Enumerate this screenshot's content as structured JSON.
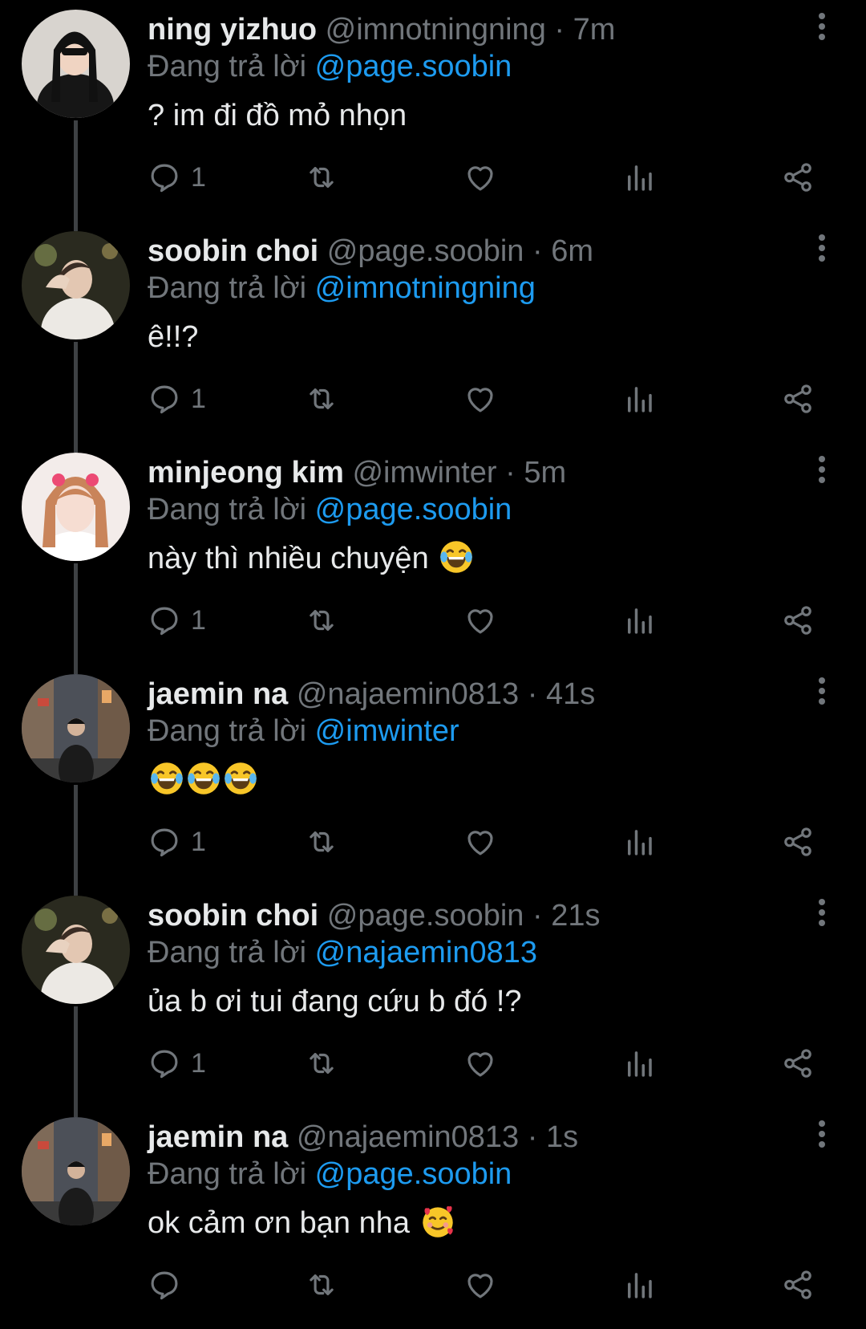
{
  "colors": {
    "background": "#000000",
    "text": "#e7e9ea",
    "muted": "#71767b",
    "mention": "#1d9bf0",
    "thread_line": "#3e4144"
  },
  "icons": {
    "reply": "speech-bubble-icon",
    "retweet": "retweet-icon",
    "like": "heart-icon",
    "views": "bar-chart-icon",
    "share": "share-icon",
    "more": "vertical-dots-icon"
  },
  "reply_prefix": "Đang trả lời",
  "tweets": [
    {
      "name": "ning yizhuo",
      "handle": "@imnotningning",
      "sep": " · ",
      "time": "7m",
      "reply_to": "@page.soobin",
      "text": "? im đi đồ mỏ nhọn",
      "emoji": "",
      "reply_count": "1"
    },
    {
      "name": "soobin choi",
      "handle": "@page.soobin",
      "sep": " · ",
      "time": "6m",
      "reply_to": "@imnotningning",
      "text": "ê!!?",
      "emoji": "",
      "reply_count": "1"
    },
    {
      "name": "minjeong kim",
      "handle": "@imwinter",
      "sep": " · ",
      "time": "5m",
      "reply_to": "@page.soobin",
      "text": "này thì nhiều chuyện ",
      "emoji": "😂",
      "reply_count": "1"
    },
    {
      "name": "jaemin na",
      "handle": "@najaemin0813",
      "sep": " · ",
      "time": "41s",
      "reply_to": "@imwinter",
      "text": "",
      "emoji": "😂😂😂",
      "reply_count": "1"
    },
    {
      "name": "soobin choi",
      "handle": "@page.soobin",
      "sep": " · ",
      "time": "21s",
      "reply_to": "@najaemin0813",
      "text": "ủa b ơi tui đang cứu b đó !?",
      "emoji": "",
      "reply_count": "1"
    },
    {
      "name": "jaemin na",
      "handle": "@najaemin0813",
      "sep": " · ",
      "time": "1s",
      "reply_to": "@page.soobin",
      "text": "ok cảm ơn bạn nha ",
      "emoji": "🥰",
      "reply_count": ""
    }
  ]
}
